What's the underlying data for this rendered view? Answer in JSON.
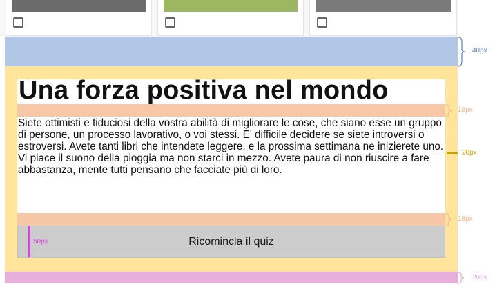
{
  "cards": [
    {
      "checked": false,
      "image_color": "#6b6b6b"
    },
    {
      "checked": false,
      "image_color": "#9cb760"
    },
    {
      "checked": false,
      "image_color": "#7a7a7a"
    }
  ],
  "main": {
    "title": "Una forza positiva nel mondo",
    "body": "Siete ottimisti e fiduciosi della vostra abilità di migliorare le cose, che siano esse un gruppo di persone, un processo lavorativo, o voi stessi. E' difficile decidere se siete introversi o estroversi. Avete tanti libri che intendete leggere, e la prossima settimana ne inizierete uno. Vi piace il suono della pioggia ma non starci in mezzo. Avete paura di non riuscire a fare abbastanza, mente tutti pensano che facciate più di loro.",
    "button_label": "Ricomincia il quiz"
  },
  "annotations": {
    "blue_band": "40px",
    "title_gap": "18px",
    "inner_padding": "20px",
    "text_gap": "18px",
    "button_padding": "50px",
    "bottom_band": "20px"
  },
  "colors": {
    "blue_band": "#b2c7e6",
    "yellow_band": "#ffe59b",
    "orange_spacer": "#f8c7a7",
    "pink_band": "#e8b0dc",
    "button_bg": "#cccccc",
    "magenta": "#e040e0"
  }
}
